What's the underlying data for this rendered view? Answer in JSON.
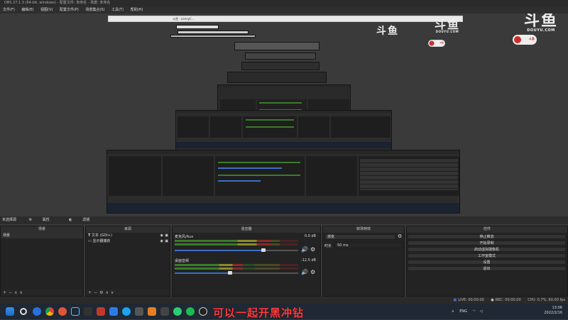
{
  "window": {
    "title": "OBS 27.1.3 (64-bit, windows) - 配置文件: 未命名 - 场景: 未命名"
  },
  "menu": [
    "文件(F)",
    "编辑(E)",
    "视图(V)",
    "配置文件(P)",
    "场景集合(S)",
    "工具(T)",
    "帮助(H)"
  ],
  "nested_title": "斗鱼 - LennyC...",
  "logos": {
    "cn": "斗鱼",
    "en": "DOUYU.COM"
  },
  "badge_text": "斗鱼",
  "scenebar": {
    "label": "未选择源",
    "properties": "属性",
    "filters": "滤镜"
  },
  "panels": {
    "scenes": {
      "title": "场景",
      "items": [
        "场景"
      ]
    },
    "sources": {
      "title": "来源",
      "items": [
        {
          "name": "文本 (GDI+)",
          "icon": "text-icon"
        },
        {
          "name": "显示器捕获",
          "icon": "monitor-icon"
        }
      ]
    },
    "mixer": {
      "title": "混音器",
      "channels": [
        {
          "name": "麦克风/Aux",
          "db": "0.0 dB",
          "level": 0.78,
          "volume": 0.72
        },
        {
          "name": "桌面音频",
          "db": "-12.5 dB",
          "level": 0.55,
          "volume": 0.45
        }
      ]
    },
    "transitions": {
      "title": "转场特效",
      "type": "渐变",
      "duration_label": "时长",
      "duration": "50 ms"
    },
    "controls": {
      "title": "控件",
      "buttons": [
        "停止推流",
        "开始录制",
        "启动虚拟摄像机",
        "工作室模式",
        "设置",
        "退出"
      ]
    }
  },
  "status": {
    "live": "LIVE: 00:00:00",
    "rec": "REC: 00:00:00",
    "cpu": "CPU: 0.7%, 60.00 fps"
  },
  "subtitle": "可以一起开黑冲钻",
  "taskbar": {
    "lang": "ENG",
    "time": "13:06",
    "date": "2022/2/16"
  },
  "colors": {
    "accent": "#3a6fc4",
    "subtitle": "#ff3b3b",
    "background": "#3a3a3a"
  }
}
